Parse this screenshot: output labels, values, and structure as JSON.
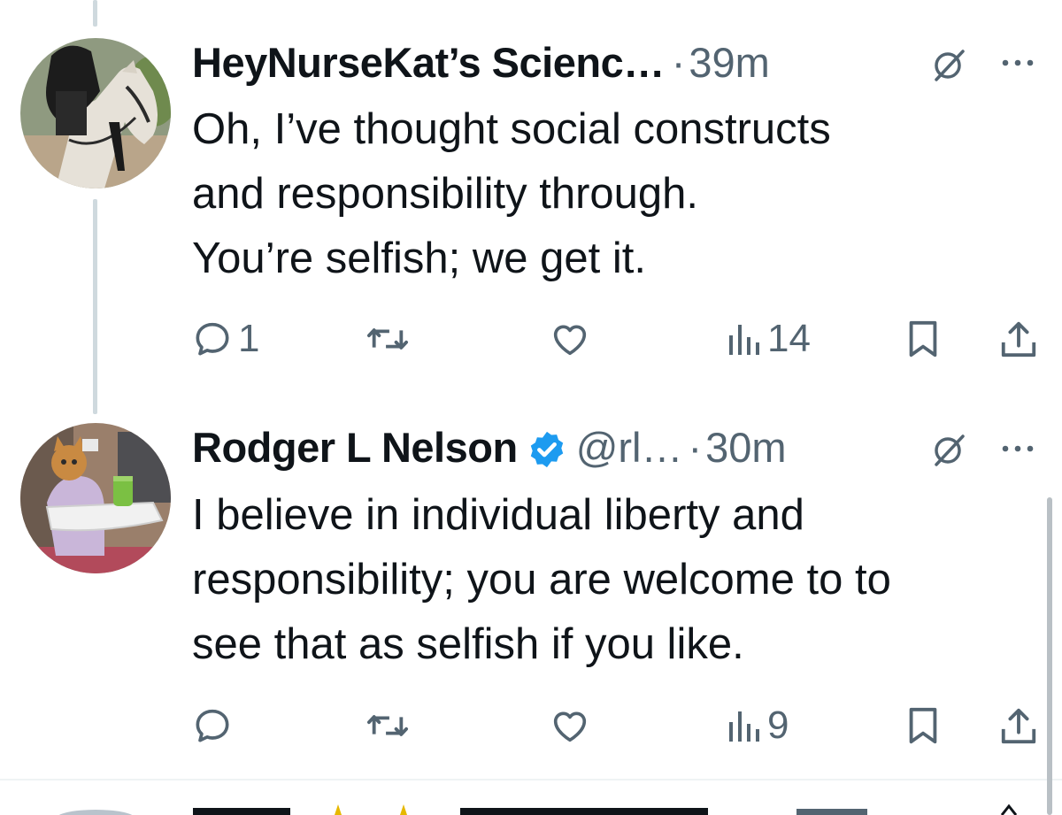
{
  "tweets": [
    {
      "author_name": "HeyNurseKat’s Scienc…",
      "separator": "·",
      "time": "39m",
      "text_lines": [
        "Oh, I’ve thought social constructs",
        "and responsibility through.",
        "You’re selfish; we get it."
      ],
      "reply_count": "1",
      "views_count": "14",
      "avatar_icon": "avatar-horse-rider",
      "verified": false
    },
    {
      "author_name": "Rodger L Nelson",
      "handle": "@rl…",
      "separator": "·",
      "time": "30m",
      "text_lines": [
        "I believe in individual liberty and",
        "responsibility; you are welcome to to",
        "see that as selfish if you like."
      ],
      "reply_count": "",
      "views_count": "9",
      "avatar_icon": "avatar-cat-in-highchair",
      "verified": true
    }
  ],
  "icons": {
    "reply": "reply-icon",
    "retweet": "retweet-icon",
    "like": "like-icon",
    "views": "views-icon",
    "bookmark": "bookmark-icon",
    "share": "share-icon",
    "grok": "grok-icon",
    "more": "more-icon",
    "verified": "verified-badge-icon"
  },
  "colors": {
    "text": "#0f1419",
    "secondary": "#536471",
    "verified_blue": "#1d9bf0",
    "thread_line": "#cfd9de"
  }
}
